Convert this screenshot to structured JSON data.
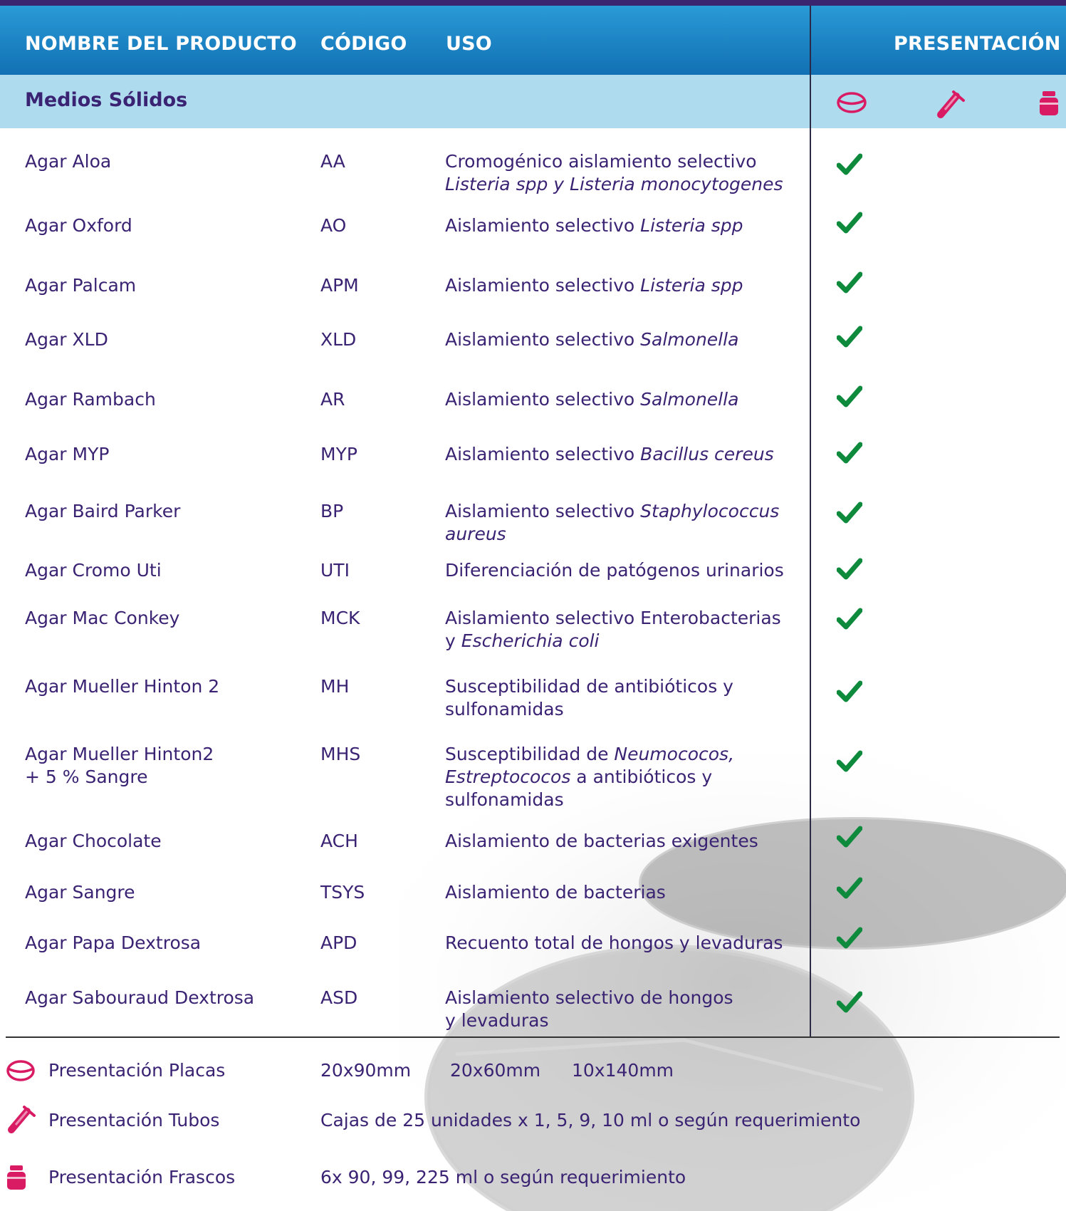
{
  "header": {
    "col_name": "NOMBRE DEL PRODUCTO",
    "col_code": "CÓDIGO",
    "col_use": "USO",
    "col_presentation": "PRESENTACIÓN"
  },
  "section": {
    "title": "Medios Sólidos",
    "icons": [
      "plate-icon",
      "tube-icon",
      "bottle-icon"
    ]
  },
  "colors": {
    "header_blue": "#1a82c4",
    "section_light_blue": "#aedbee",
    "text_purple": "#3a2373",
    "check_green": "#0e8a3c",
    "icon_magenta": "#d81b63"
  },
  "rows": [
    {
      "name": "Agar Aloa",
      "name2": "",
      "code": "AA",
      "use1a": "Cromogénico aislamiento selectivo",
      "use1b": "",
      "use2a": "",
      "use2b": "Listeria spp y Listeria monocytogenes",
      "use3": "",
      "placas": true
    },
    {
      "name": "Agar Oxford",
      "name2": "",
      "code": "AO",
      "use1a": "Aislamiento selectivo ",
      "use1b": "Listeria spp",
      "use2a": "",
      "use2b": "",
      "use3": "",
      "placas": true
    },
    {
      "name": "Agar Palcam",
      "name2": "",
      "code": "APM",
      "use1a": "Aislamiento selectivo ",
      "use1b": "Listeria spp",
      "use2a": "",
      "use2b": "",
      "use3": "",
      "placas": true
    },
    {
      "name": "Agar XLD",
      "name2": "",
      "code": "XLD",
      "use1a": "Aislamiento selectivo ",
      "use1b": "Salmonella",
      "use2a": "",
      "use2b": "",
      "use3": "",
      "placas": true
    },
    {
      "name": "Agar Rambach",
      "name2": "",
      "code": "AR",
      "use1a": "Aislamiento selectivo ",
      "use1b": "Salmonella",
      "use2a": "",
      "use2b": "",
      "use3": "",
      "placas": true
    },
    {
      "name": "Agar MYP",
      "name2": "",
      "code": "MYP",
      "use1a": "Aislamiento selectivo ",
      "use1b": "Bacillus cereus",
      "use2a": "",
      "use2b": "",
      "use3": "",
      "placas": true
    },
    {
      "name": "Agar Baird Parker",
      "name2": "",
      "code": "BP",
      "use1a": "Aislamiento selectivo ",
      "use1b": "Staphylococcus",
      "use2a": "",
      "use2b": "aureus",
      "use3": "",
      "placas": true
    },
    {
      "name": "Agar Cromo Uti",
      "name2": "",
      "code": "UTI",
      "use1a": "Diferenciación de patógenos urinarios",
      "use1b": "",
      "use2a": "",
      "use2b": "",
      "use3": "",
      "placas": true
    },
    {
      "name": "Agar Mac Conkey",
      "name2": "",
      "code": "MCK",
      "use1a": "Aislamiento selectivo  Enterobacterias",
      "use1b": "",
      "use2a": "y ",
      "use2b": "Escherichia coli",
      "use3": "",
      "placas": true
    },
    {
      "name": "Agar Mueller Hinton 2",
      "name2": "",
      "code": "MH",
      "use1a": "Susceptibilidad  de antibióticos y",
      "use1b": "",
      "use2a": "sulfonamidas",
      "use2b": "",
      "use3": "",
      "placas": true
    },
    {
      "name": "Agar Mueller Hinton2",
      "name2": "+ 5 % Sangre",
      "code": "MHS",
      "use1a": "Susceptibilidad de ",
      "use1b": "Neumococos,",
      "use2a": "",
      "use2b": "Estreptococos",
      "use2c": " a antibióticos y",
      "use3": "sulfonamidas",
      "placas": true
    },
    {
      "name": "Agar Chocolate",
      "name2": "",
      "code": "ACH",
      "use1a": "Aislamiento de bacterias exigentes",
      "use1b": "",
      "use2a": "",
      "use2b": "",
      "use3": "",
      "placas": true
    },
    {
      "name": "Agar Sangre",
      "name2": "",
      "code": "TSYS",
      "use1a": "Aislamiento de bacterias",
      "use1b": "",
      "use2a": "",
      "use2b": "",
      "use3": "",
      "placas": true
    },
    {
      "name": "Agar Papa Dextrosa",
      "name2": "",
      "code": "APD",
      "use1a": "Recuento total de hongos y levaduras",
      "use1b": "",
      "use2a": "",
      "use2b": "",
      "use3": "",
      "placas": true
    },
    {
      "name": "Agar Sabouraud  Dextrosa",
      "name2": "",
      "code": "ASD",
      "use1a": "Aislamiento selectivo de hongos",
      "use1b": "",
      "use2a": "y levaduras",
      "use2b": "",
      "use3": "",
      "placas": true
    }
  ],
  "legend": {
    "placas_label": "Presentación Placas",
    "placas_size1": "20x90mm",
    "placas_size2": "20x60mm",
    "placas_size3": "10x140mm",
    "tubos_label": "Presentación Tubos",
    "tubos_desc": "Cajas de 25 unidades x 1, 5, 9, 10 ml o según requerimiento",
    "frascos_label": "Presentación Frascos",
    "frascos_desc": "6x 90, 99, 225 ml o según requerimiento"
  }
}
